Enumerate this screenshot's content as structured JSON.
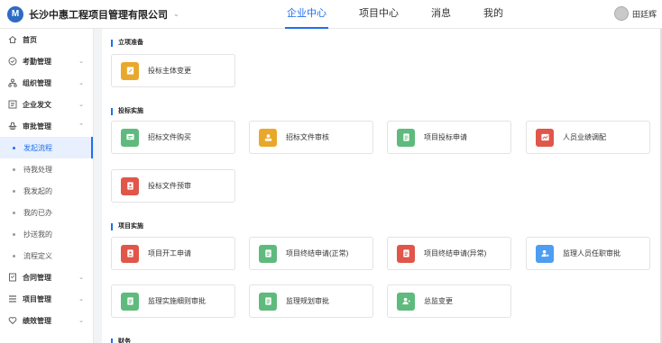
{
  "header": {
    "logo_char": "M",
    "company": "长沙中惠工程项目管理有限公司",
    "company_chevron": "⌄",
    "nav": [
      {
        "label": "企业中心",
        "active": true
      },
      {
        "label": "项目中心",
        "active": false
      },
      {
        "label": "消息",
        "active": false
      },
      {
        "label": "我的",
        "active": false
      }
    ],
    "user_name": "田廷辉"
  },
  "sidebar": {
    "items": [
      {
        "label": "首页",
        "icon": "home-icon",
        "type": "group",
        "chevron": ""
      },
      {
        "label": "考勤管理",
        "icon": "clock-icon",
        "type": "group",
        "chevron": "⌄"
      },
      {
        "label": "组织管理",
        "icon": "org-icon",
        "type": "group",
        "chevron": "⌄"
      },
      {
        "label": "企业发文",
        "icon": "doc-icon",
        "type": "group",
        "chevron": "⌄"
      },
      {
        "label": "审批管理",
        "icon": "approval-icon",
        "type": "group",
        "chevron": "⌃"
      },
      {
        "label": "发起流程",
        "type": "sub",
        "active": true
      },
      {
        "label": "待我处理",
        "type": "sub"
      },
      {
        "label": "我发起的",
        "type": "sub"
      },
      {
        "label": "我的已办",
        "type": "sub"
      },
      {
        "label": "抄送我的",
        "type": "sub"
      },
      {
        "label": "流程定义",
        "type": "sub"
      },
      {
        "label": "合同管理",
        "icon": "contract-icon",
        "type": "group",
        "chevron": "⌄"
      },
      {
        "label": "项目管理",
        "icon": "project-icon",
        "type": "group",
        "chevron": "⌄"
      },
      {
        "label": "绩效管理",
        "icon": "performance-icon",
        "type": "group",
        "chevron": "⌄"
      }
    ]
  },
  "sections": [
    {
      "title": "立项准备"
    },
    {
      "title": "投标实施"
    },
    {
      "title": "项目实施"
    },
    {
      "title": "财务"
    }
  ],
  "cards": [
    {
      "label": "投标主体变更",
      "color": "#e9a82b",
      "icon": "edit-doc-icon"
    },
    {
      "label": "招标文件购买",
      "color": "#5fba7d",
      "icon": "chat-card-icon"
    },
    {
      "label": "招标文件审核",
      "color": "#e9a82b",
      "icon": "user-card-icon"
    },
    {
      "label": "项目投标申请",
      "color": "#5fba7d",
      "icon": "list-doc-icon"
    },
    {
      "label": "人员业绩调配",
      "color": "#e0564a",
      "icon": "chart-card-icon"
    },
    {
      "label": "投标文件预审",
      "color": "#e0564a",
      "icon": "person-doc-icon"
    },
    {
      "label": "项目开工申请",
      "color": "#e0564a",
      "icon": "person-doc-icon"
    },
    {
      "label": "项目终结申请(正常)",
      "color": "#5fba7d",
      "icon": "list-doc-icon"
    },
    {
      "label": "项目终结申请(异常)",
      "color": "#e0564a",
      "icon": "list-doc-icon"
    },
    {
      "label": "监理人员任职审批",
      "color": "#4d9df0",
      "icon": "user-badge-icon"
    },
    {
      "label": "监理实施细则审批",
      "color": "#5fba7d",
      "icon": "list-doc-icon"
    },
    {
      "label": "监理规划审批",
      "color": "#5fba7d",
      "icon": "list-doc-icon"
    },
    {
      "label": "总监变更",
      "color": "#5fba7d",
      "icon": "user-change-icon"
    }
  ]
}
